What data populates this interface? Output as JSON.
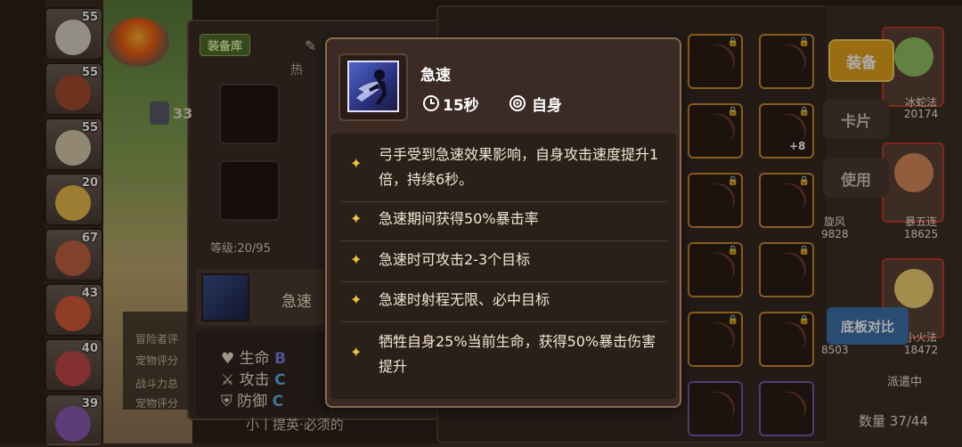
{
  "left_heroes": {
    "levels": [
      "55",
      "55",
      "55",
      "20",
      "67",
      "43",
      "40",
      "39"
    ]
  },
  "equip_panel": {
    "tab_label": "装备库",
    "partial_label": "热",
    "rating_partial": "33",
    "level_text": "等级:20/95",
    "skill_name": "急速",
    "stats": [
      {
        "label": "生命",
        "grade": "B"
      },
      {
        "label": "攻击",
        "grade": "C"
      },
      {
        "label": "防御",
        "grade": "C"
      }
    ],
    "side_texts": [
      "冒险者评",
      "宠物评分",
      "战斗力总",
      "宠物评分"
    ],
    "bottom_text": "小丨提英·必须的"
  },
  "right_panel": {
    "equip_button": "装备",
    "card_button": "卡片",
    "use_button": "使用",
    "compare_button": "底板对比",
    "hero_cards": [
      {
        "name": "冰蛇法",
        "power": "20174"
      },
      {
        "name": "暴五连",
        "power": "18625"
      },
      {
        "name": "小火法",
        "power": "18472"
      }
    ],
    "partial_names": [
      "旋风",
      "9828",
      "8503"
    ],
    "dispatch": "派遣中",
    "count": "数量 37/44",
    "plus_label": "+8"
  },
  "tooltip": {
    "title": "急速",
    "duration": "15秒",
    "target": "自身",
    "descriptions": [
      "弓手受到急速效果影响，自身攻击速度提升1倍，持续6秒。",
      "急速期间获得50%暴击率",
      "急速时可攻击2-3个目标",
      "急速时射程无限、必中目标",
      "牺牲自身25%当前生命，获得50%暴击伤害提升"
    ]
  },
  "colors": {
    "accent_gold": "#e2a21c",
    "star": "#f3c43a",
    "compare_blue": "#3f6fa8"
  }
}
